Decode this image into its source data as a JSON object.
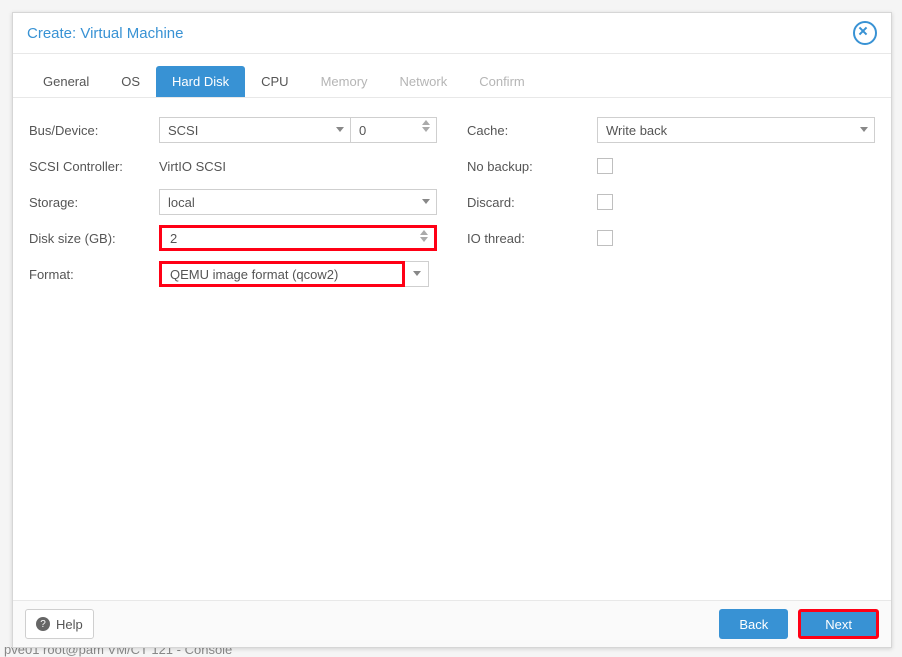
{
  "dialog": {
    "title": "Create: Virtual Machine"
  },
  "tabs": {
    "general": "General",
    "os": "OS",
    "hard_disk": "Hard Disk",
    "cpu": "CPU",
    "memory": "Memory",
    "network": "Network",
    "confirm": "Confirm"
  },
  "left": {
    "bus_device_label": "Bus/Device:",
    "bus_value": "SCSI",
    "device_value": "0",
    "scsi_controller_label": "SCSI Controller:",
    "scsi_controller_value": "VirtIO SCSI",
    "storage_label": "Storage:",
    "storage_value": "local",
    "disk_size_label": "Disk size (GB):",
    "disk_size_value": "2",
    "format_label": "Format:",
    "format_value": "QEMU image format (qcow2)"
  },
  "right": {
    "cache_label": "Cache:",
    "cache_value": "Write back",
    "no_backup_label": "No backup:",
    "discard_label": "Discard:",
    "io_thread_label": "IO thread:"
  },
  "footer": {
    "help": "Help",
    "back": "Back",
    "next": "Next"
  },
  "background": {
    "line": "pve01             root@pam                       VM/CT 121 - Console"
  }
}
